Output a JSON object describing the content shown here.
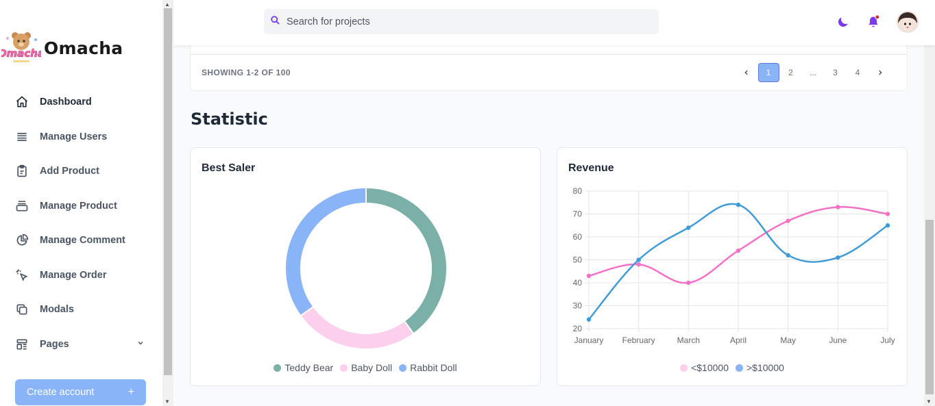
{
  "sidebar": {
    "brand": "Omacha",
    "items": [
      {
        "label": "Dashboard",
        "icon": "home-icon"
      },
      {
        "label": "Manage Users",
        "icon": "list-icon"
      },
      {
        "label": "Add Product",
        "icon": "clipboard-icon"
      },
      {
        "label": "Manage Product",
        "icon": "box-icon"
      },
      {
        "label": "Manage Comment",
        "icon": "pie-icon"
      },
      {
        "label": "Manage Order",
        "icon": "cursor-click-icon"
      },
      {
        "label": "Modals",
        "icon": "duplicate-icon"
      },
      {
        "label": "Pages",
        "icon": "template-icon"
      }
    ],
    "create_label": "Create account",
    "create_plus": "+"
  },
  "header": {
    "search_placeholder": "Search for projects"
  },
  "table": {
    "showing": "SHOWING 1-2 OF 100",
    "pages": [
      "1",
      "2",
      "...",
      "3",
      "4"
    ],
    "prev": "‹",
    "next": "›"
  },
  "section_title": "Statistic",
  "colors": {
    "teddy": "#7ab0a8",
    "baby": "#fccfec",
    "rabbit": "#8ab4f8",
    "pink_line": "#f472c6",
    "blue_line": "#3d9bd8",
    "accent": "#8ab4f8",
    "moon": "#7c3aed",
    "bell": "#7c3aed",
    "notify": "#dc2626"
  },
  "chart_data": [
    {
      "type": "pie",
      "title": "Best Saler",
      "categories": [
        "Teddy Bear",
        "Baby Doll",
        "Rabbit Doll"
      ],
      "values": [
        40,
        25,
        35
      ],
      "donut": true
    },
    {
      "type": "line",
      "title": "Revenue",
      "x": [
        "January",
        "February",
        "March",
        "April",
        "May",
        "June",
        "July"
      ],
      "ylim": [
        20,
        80
      ],
      "yticks": [
        20,
        30,
        40,
        50,
        60,
        70,
        80
      ],
      "grid": true,
      "legend": "bottom",
      "series": [
        {
          "name": "<$10000",
          "values": [
            43,
            48,
            40,
            54,
            67,
            73,
            70
          ]
        },
        {
          "name": ">$10000",
          "values": [
            24,
            50,
            64,
            74,
            52,
            51,
            65
          ]
        }
      ]
    }
  ]
}
